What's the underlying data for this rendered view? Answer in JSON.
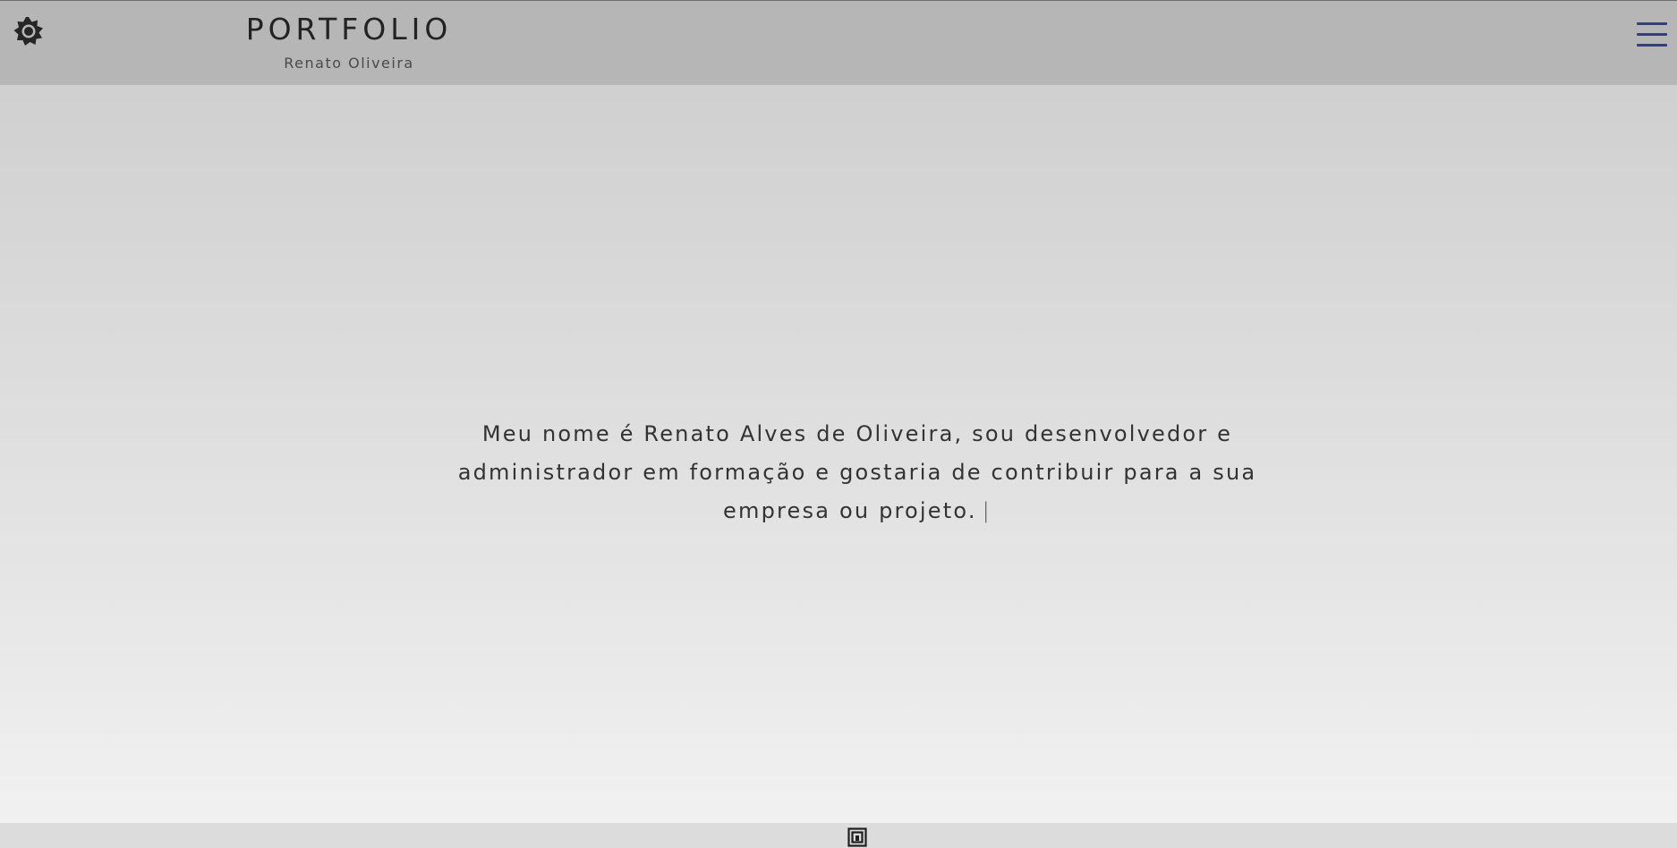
{
  "header": {
    "title": "PORTFOLIO",
    "subtitle": "Renato Oliveira",
    "theme_toggle_icon": "gear-icon",
    "menu_icon": "hamburger-menu-icon",
    "accent_color": "#2f3f8e"
  },
  "main": {
    "intro_text": "Meu nome é Renato Alves de Oliveira, sou desenvolvedor e administrador em formação e gostaria de contribuir para a sua empresa ou projeto.",
    "cursor": "|"
  },
  "footer": {
    "logo_icon": "logo-icon"
  }
}
